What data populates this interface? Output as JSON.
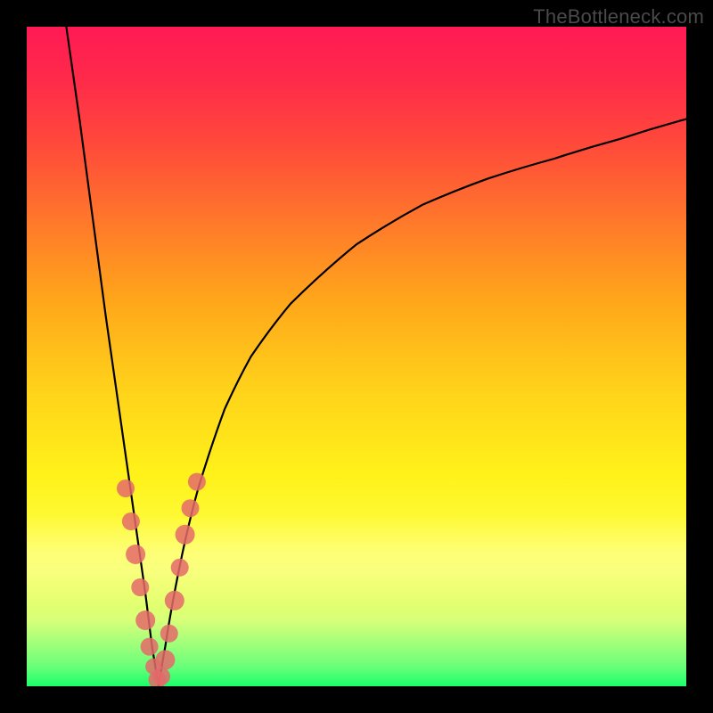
{
  "watermark": "TheBottleneck.com",
  "colors": {
    "frame": "#000000",
    "curve": "#000000",
    "marker_fill": "#e46a6a",
    "marker_stroke": "#c04a4a"
  },
  "chart_data": {
    "type": "line",
    "title": "",
    "xlabel": "",
    "ylabel": "",
    "xlim": [
      0,
      100
    ],
    "ylim": [
      0,
      100
    ],
    "grid": false,
    "note": "V-shaped bottleneck curve. Vertex at x≈20, y≈0. Left branch rises steeply toward y≈100 near x≈6. Right branch rises diminishingly, approaching y≈86 at x=100. y=0 (green) = optimal; y=100 (red) = severe bottleneck. Axis values estimated from visual position only (no ticks in image).",
    "series": [
      {
        "name": "bottleneck-curve",
        "x": [
          6,
          8,
          10,
          12,
          14,
          16,
          18,
          19,
          20,
          21,
          22,
          24,
          26,
          30,
          34,
          40,
          50,
          60,
          70,
          80,
          90,
          100
        ],
        "values": [
          100,
          86,
          71,
          56,
          42,
          28,
          14,
          6,
          0,
          6,
          12,
          22,
          30,
          42,
          50,
          58,
          67,
          73,
          77,
          80,
          83,
          86
        ]
      }
    ],
    "markers": {
      "name": "sample-points",
      "note": "Pink dots clustered around the vertex on both branches (approx y 0–30 range).",
      "x": [
        15.0,
        15.8,
        16.5,
        17.2,
        18.0,
        18.6,
        19.2,
        19.8,
        20.4,
        21.0,
        21.6,
        22.4,
        23.2,
        24.0,
        24.8,
        25.8
      ],
      "values": [
        30.0,
        25.0,
        20.0,
        15.0,
        10.0,
        6.0,
        3.0,
        1.0,
        1.5,
        4.0,
        8.0,
        13.0,
        18.0,
        23.0,
        27.0,
        31.0
      ],
      "r": [
        10,
        10,
        11,
        10,
        11,
        10,
        9,
        10,
        10,
        11,
        10,
        11,
        10,
        11,
        10,
        10
      ]
    }
  }
}
